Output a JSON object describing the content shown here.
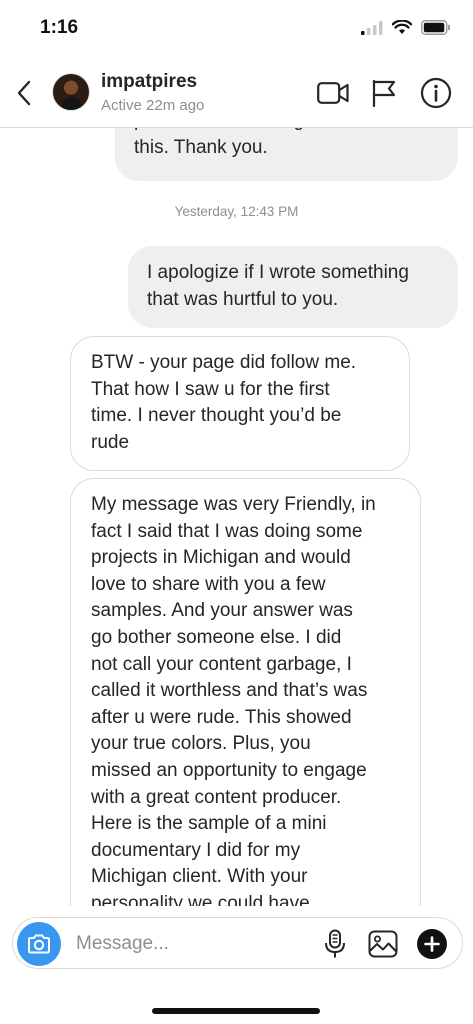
{
  "status_bar": {
    "time": "1:16"
  },
  "header": {
    "username": "impatpires",
    "active_status": "Active 22m ago",
    "icons": [
      "back-chevron-icon",
      "video-camera-icon",
      "flag-icon",
      "info-icon"
    ]
  },
  "messages": [
    {
      "direction": "outgoing",
      "lines": [
        "practice has nothing to do with",
        "this. Thank you."
      ]
    },
    {
      "type": "timestamp",
      "text": "Yesterday, 12:43 PM"
    },
    {
      "direction": "outgoing",
      "lines": [
        "I apologize if I wrote something",
        "that was hurtful to you."
      ]
    },
    {
      "direction": "incoming",
      "lines": [
        "BTW - your page did follow me.",
        "That how I saw u for the first",
        "time.  I never thought you’d be",
        "rude"
      ]
    },
    {
      "direction": "incoming",
      "lines": [
        "My message was very Friendly, in",
        "fact I said that I was doing some",
        "projects in Michigan and would",
        "love to share with you a few",
        "samples. And your answer was",
        "go bother someone else.  I did",
        "not call your content garbage, I",
        "called it worthless and that’s was",
        "after u were rude. This showed",
        "your true colors.  Plus, you",
        "missed an opportunity to engage",
        "with a great content producer.",
        "Here is the sample of a mini",
        "documentary I did for my",
        "Michigan client.  With your",
        "personality   we could have"
      ]
    }
  ],
  "composer": {
    "placeholder": "Message...",
    "icons": [
      "camera-icon",
      "microphone-icon",
      "gallery-icon",
      "add-icon"
    ]
  },
  "colors": {
    "accent": "#3897f0",
    "outgoing_bubble": "#efefef",
    "incoming_border": "#dbdbdb",
    "secondary_text": "#8e8e8e"
  }
}
